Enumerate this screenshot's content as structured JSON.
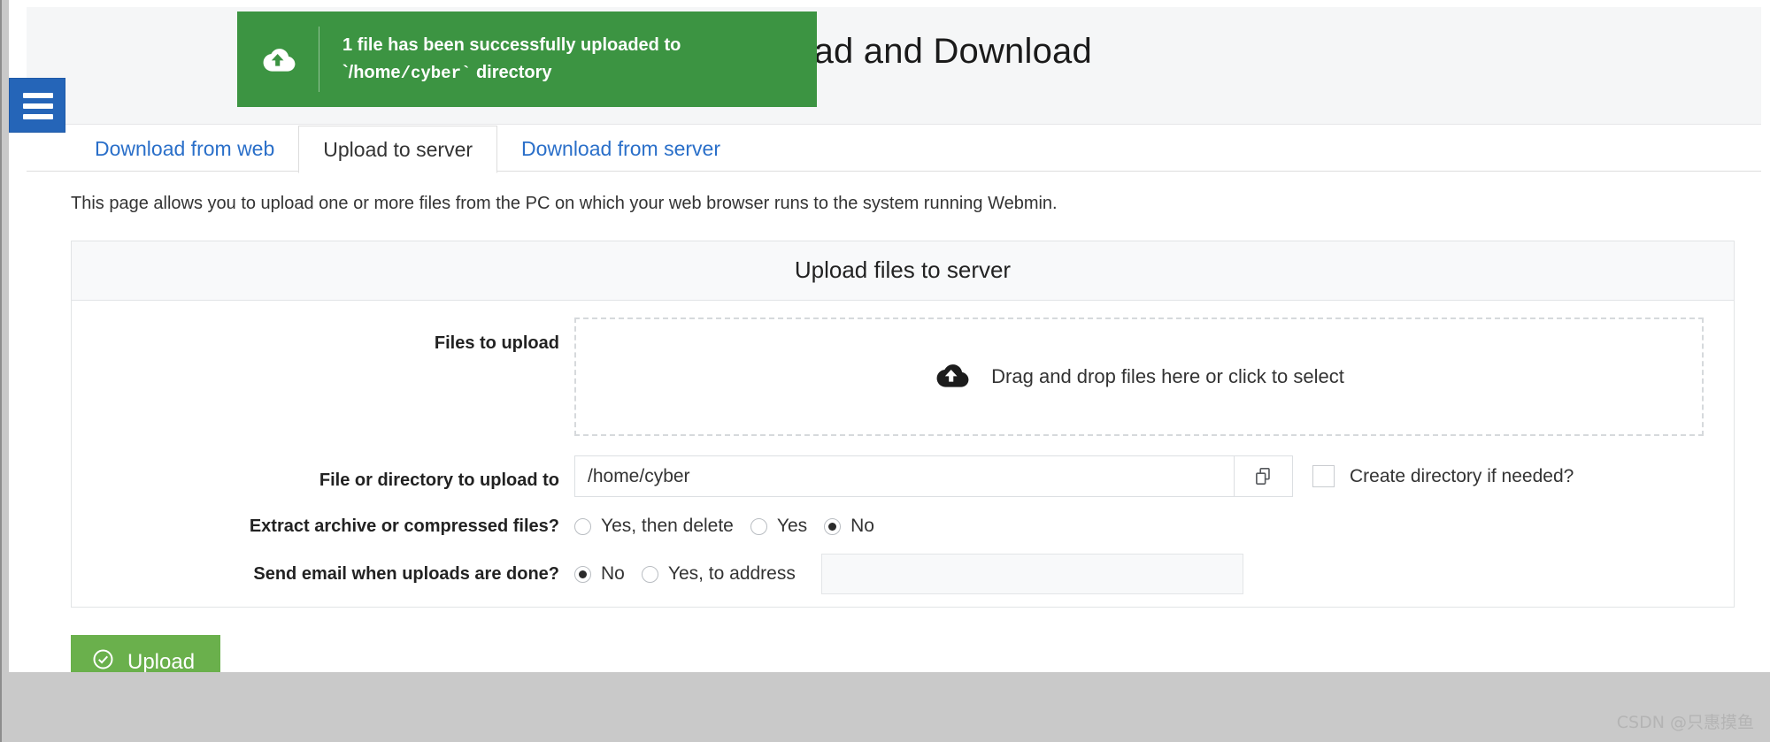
{
  "window": {
    "page_title": "Upload and Download",
    "favorite_icon": "star-icon",
    "menu_icon": "hamburger-menu-icon"
  },
  "toast": {
    "icon": "cloud-upload-icon",
    "text_part1": "1 file has been successfully uploaded to `/home",
    "text_part2": "/cyber`",
    "text_part3": " directory",
    "background_color": "#3c9442"
  },
  "tabs": [
    {
      "label": "Download from web",
      "active": false
    },
    {
      "label": "Upload to server",
      "active": true
    },
    {
      "label": "Download from server",
      "active": false
    }
  ],
  "description": "This page allows you to upload one or more files from the PC on which your web browser runs to the system running Webmin.",
  "panel": {
    "header": "Upload files to server",
    "rows": {
      "files_to_upload": {
        "label": "Files to upload",
        "dropzone_icon": "cloud-upload-icon",
        "dropzone_text": "Drag and drop files here or click to select"
      },
      "upload_path": {
        "label": "File or directory to upload to",
        "value": "/home/cyber",
        "browse_icon": "file-chooser-icon",
        "checkbox_label": "Create directory if needed?",
        "checkbox_checked": false
      },
      "extract": {
        "label": "Extract archive or compressed files?",
        "options": [
          {
            "label": "Yes, then delete",
            "selected": false
          },
          {
            "label": "Yes",
            "selected": false
          },
          {
            "label": "No",
            "selected": true
          }
        ]
      },
      "send_email": {
        "label": "Send email when uploads are done?",
        "options": [
          {
            "label": "No",
            "selected": true
          },
          {
            "label": "Yes, to address",
            "selected": false
          }
        ],
        "address_value": "",
        "address_placeholder": ""
      }
    }
  },
  "actions": {
    "upload_label": "Upload",
    "upload_icon": "check-circle-icon",
    "upload_color": "#6ab04c"
  },
  "watermark": "CSDN @只惠摸鱼"
}
